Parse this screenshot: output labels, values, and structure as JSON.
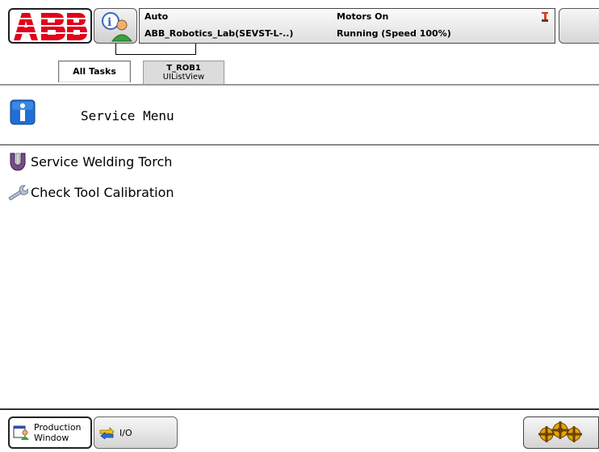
{
  "status": {
    "mode": "Auto",
    "controller": "ABB_Robotics_Lab(SEVST-L-..)",
    "motors": "Motors On",
    "running": "Running (Speed 100%)"
  },
  "tabs": [
    {
      "label": "All Tasks"
    },
    {
      "label": "T_ROB1",
      "sublabel": "UIListView"
    }
  ],
  "page": {
    "title": "Service Menu"
  },
  "menu_items": [
    {
      "label": "Service Welding Torch",
      "icon": "welding-torch-icon"
    },
    {
      "label": "Check Tool Calibration",
      "icon": "wrench-icon"
    }
  ],
  "taskbar": {
    "production_label": "Production\nWindow",
    "io_label": "I/O"
  },
  "colors": {
    "abb_red": "#e2001a",
    "info_blue": "#1f6fd6"
  }
}
